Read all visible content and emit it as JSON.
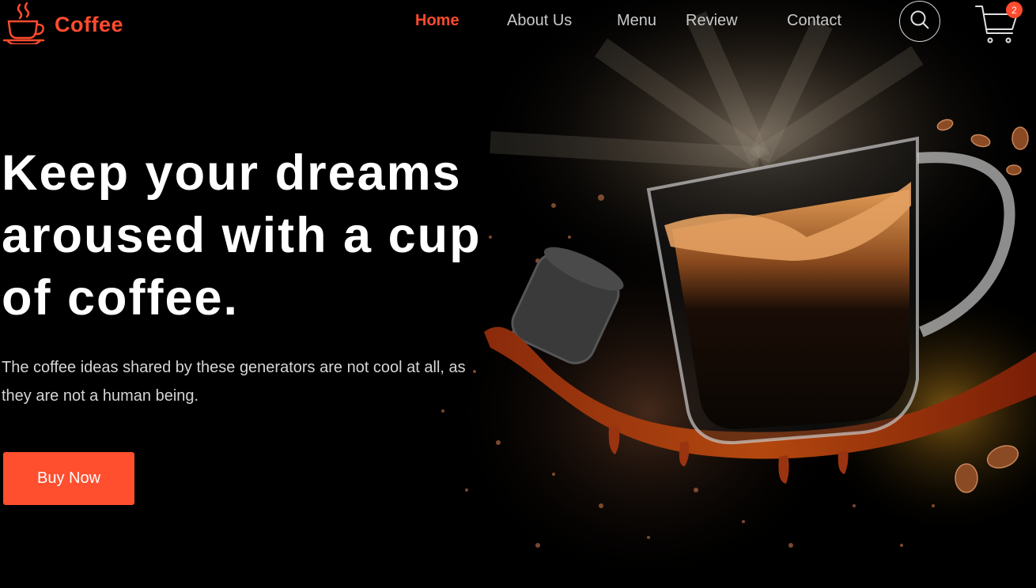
{
  "brand": {
    "name": "Coffee",
    "logo_icon": "coffee-cup-icon"
  },
  "nav": {
    "items": [
      {
        "label": "Home",
        "active": true
      },
      {
        "label": "About Us",
        "active": false
      },
      {
        "label": "Menu",
        "active": false
      },
      {
        "label": "Review",
        "active": false
      },
      {
        "label": "Contact",
        "active": false
      }
    ]
  },
  "header_actions": {
    "search_icon": "search-icon",
    "cart_icon": "cart-icon",
    "cart_count": "2"
  },
  "hero": {
    "headline": "Keep your dreams aroused with a cup of coffee.",
    "subtext": "The coffee ideas shared by these generators are not cool at all, as they are not a human being.",
    "cta_label": "Buy Now",
    "image": "coffee-cup-splash-illustration"
  },
  "colors": {
    "accent": "#ff4b2e",
    "background": "#000000",
    "text": "#ffffff",
    "nav_text": "#c9c9c9"
  }
}
